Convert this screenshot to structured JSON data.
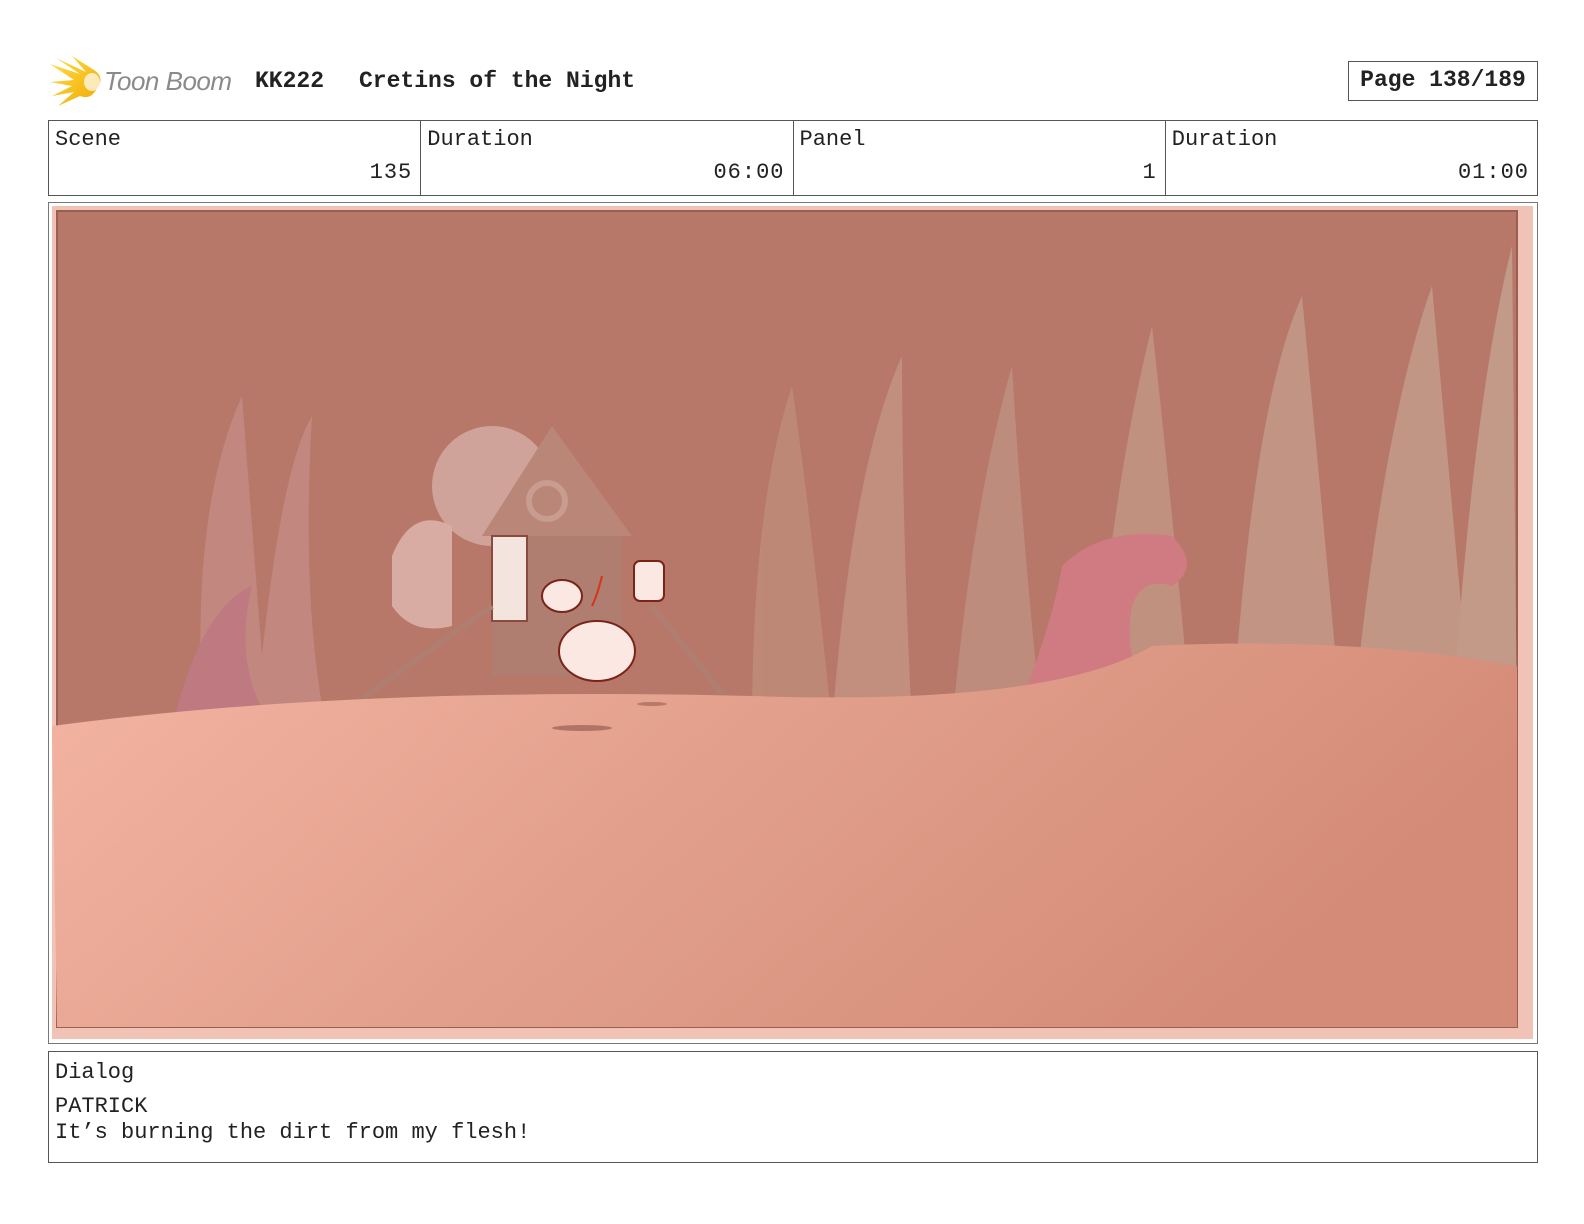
{
  "header": {
    "logo_text": "Toon Boom",
    "production_code": "KK222",
    "title": "Cretins of the Night",
    "page_label": "Page 138/189"
  },
  "info": {
    "scene_label": "Scene",
    "scene_value": "135",
    "scene_duration_label": "Duration",
    "scene_duration_value": "06:00",
    "panel_label": "Panel",
    "panel_value": "1",
    "panel_duration_label": "Duration",
    "panel_duration_value": "01:00"
  },
  "panel_image": {
    "description_icon": "storyboard-panel-image",
    "tint_color": "#b87a6c"
  },
  "dialog": {
    "label": "Dialog",
    "speaker": "PATRICK",
    "line": "It’s burning the dirt from my flesh!"
  },
  "colors": {
    "logo_flame": "#f5c518",
    "border": "#555555",
    "sky": "#b77769",
    "ground": "#e3a08c"
  }
}
